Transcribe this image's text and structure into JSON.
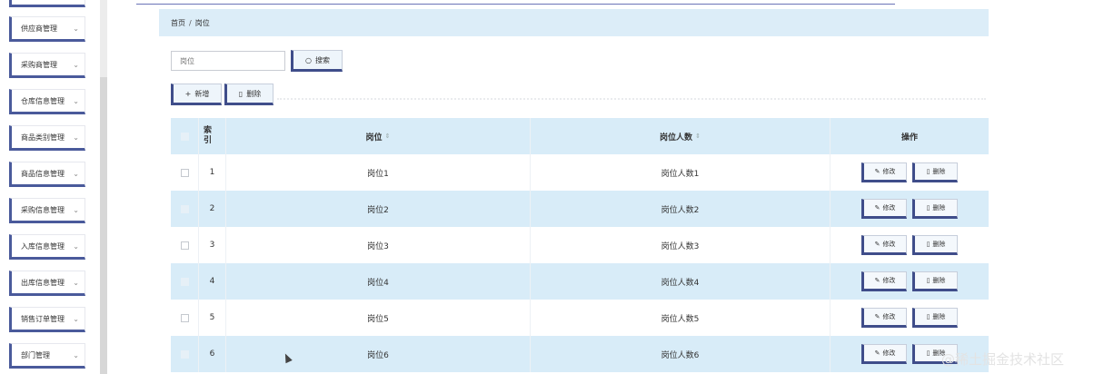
{
  "sidebar": {
    "items": [
      {
        "label": "供应商管理"
      },
      {
        "label": "采购商管理"
      },
      {
        "label": "仓库信息管理"
      },
      {
        "label": "商品类别管理"
      },
      {
        "label": "商品信息管理"
      },
      {
        "label": "采购信息管理"
      },
      {
        "label": "入库信息管理"
      },
      {
        "label": "出库信息管理"
      },
      {
        "label": "销售订单管理"
      },
      {
        "label": "部门管理"
      }
    ]
  },
  "breadcrumb": {
    "home": "首页",
    "separator": "/",
    "current": "岗位"
  },
  "search": {
    "placeholder": "岗位",
    "button_label": "搜索"
  },
  "toolbar": {
    "add_label": "新增",
    "delete_label": "删除"
  },
  "table": {
    "headers": {
      "index": "索引",
      "position": "岗位",
      "count": "岗位人数",
      "actions": "操作"
    },
    "rows": [
      {
        "index": "1",
        "position": "岗位1",
        "count": "岗位人数1"
      },
      {
        "index": "2",
        "position": "岗位2",
        "count": "岗位人数2"
      },
      {
        "index": "3",
        "position": "岗位3",
        "count": "岗位人数3"
      },
      {
        "index": "4",
        "position": "岗位4",
        "count": "岗位人数4"
      },
      {
        "index": "5",
        "position": "岗位5",
        "count": "岗位人数5"
      },
      {
        "index": "6",
        "position": "岗位6",
        "count": "岗位人数6"
      }
    ],
    "row_actions": {
      "edit_label": "修改",
      "delete_label": "删除"
    }
  },
  "watermark": "@稀土掘金技术社区",
  "colors": {
    "accent": "#3f4d8a",
    "header_bg": "#d8ecf8",
    "breadcrumb_bg": "#dcedf8"
  }
}
